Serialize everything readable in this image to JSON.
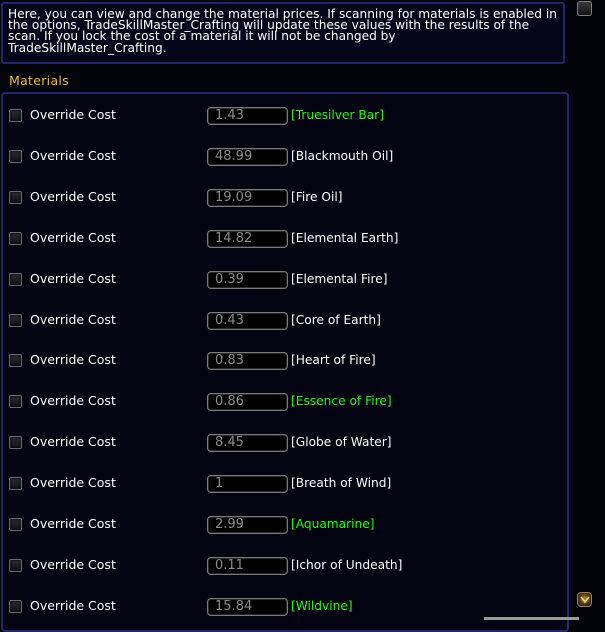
{
  "info": {
    "text": "Here, you can view and change the material prices. If scanning for materials is enabled in the options, TradeSkillMaster_Crafting will update these values with the results of the scan. If you lock the cost of a material it will not be changed by TradeSkillMaster_Crafting."
  },
  "section": {
    "title": "Materials"
  },
  "colors": {
    "section_title": "#f0c020",
    "common_item": "#ffffff",
    "uncommon_item": "#1eff00",
    "panel_border": "#23276a"
  },
  "materials": {
    "override_label": "Override Cost",
    "rows": [
      {
        "cost": "1.43",
        "name": "[Truesilver Bar]",
        "quality": "uncommon",
        "override_checked": false
      },
      {
        "cost": "48.99",
        "name": "[Blackmouth Oil]",
        "quality": "common",
        "override_checked": false
      },
      {
        "cost": "19.09",
        "name": "[Fire Oil]",
        "quality": "common",
        "override_checked": false
      },
      {
        "cost": "14.82",
        "name": "[Elemental Earth]",
        "quality": "common",
        "override_checked": false
      },
      {
        "cost": "0.39",
        "name": "[Elemental Fire]",
        "quality": "common",
        "override_checked": false
      },
      {
        "cost": "0.43",
        "name": "[Core of Earth]",
        "quality": "common",
        "override_checked": false
      },
      {
        "cost": "0.83",
        "name": "[Heart of Fire]",
        "quality": "common",
        "override_checked": false
      },
      {
        "cost": "0.86",
        "name": "[Essence of Fire]",
        "quality": "uncommon",
        "override_checked": false
      },
      {
        "cost": "8.45",
        "name": "[Globe of Water]",
        "quality": "common",
        "override_checked": false
      },
      {
        "cost": "1",
        "name": "[Breath of Wind]",
        "quality": "common",
        "override_checked": false
      },
      {
        "cost": "2.99",
        "name": "[Aquamarine]",
        "quality": "uncommon",
        "override_checked": false
      },
      {
        "cost": "0.11",
        "name": "[Ichor of Undeath]",
        "quality": "common",
        "override_checked": false
      },
      {
        "cost": "15.84",
        "name": "[Wildvine]",
        "quality": "uncommon",
        "override_checked": false
      }
    ]
  },
  "scrollbar": {
    "up_icon": "scroll-up-button",
    "thumb_icon": "scroll-thumb-icon"
  }
}
